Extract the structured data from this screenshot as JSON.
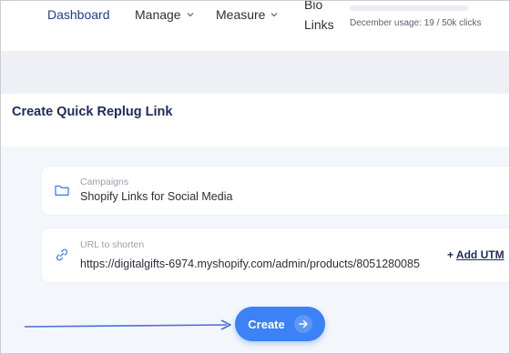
{
  "nav": {
    "dashboard": "Dashboard",
    "manage": "Manage",
    "measure": "Measure",
    "bio_line1": "Bio",
    "bio_line2": "Links",
    "usage_text": "December usage: 19 / 50k clicks",
    "usage_fraction": 0.0004
  },
  "page": {
    "title": "Create Quick Replug Link"
  },
  "campaign": {
    "label": "Campaigns",
    "value": "Shopify Links for Social Media",
    "icon": "folder-icon"
  },
  "url": {
    "label": "URL to shorten",
    "value": "https://digitalgifts-6974.myshopify.com/admin/products/8051280085",
    "icon": "link-icon"
  },
  "utm": {
    "plus": "+",
    "label": "Add UTM"
  },
  "create": {
    "label": "Create",
    "icon": "arrow-right-icon"
  },
  "colors": {
    "accent": "#3b82f6",
    "title": "#1f2a5a",
    "nav_active": "#243b8e"
  }
}
